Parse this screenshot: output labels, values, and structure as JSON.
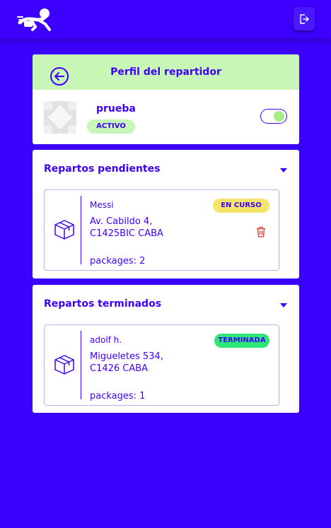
{
  "header": {
    "logo_icon": "courier-logo-icon",
    "logout_icon": "logout-icon"
  },
  "profile": {
    "title": "Perfil del repartidor",
    "back_icon": "back-arrow-circle-icon",
    "username": "prueba",
    "status": "ACTIVO",
    "active": true
  },
  "pending": {
    "title": "Repartos pendientes",
    "items": [
      {
        "client": "Messi",
        "address": "Av. Cabildo 4, C1425BIC CABA",
        "packages": "packages: 2",
        "status": "EN CURSO",
        "status_color": "#f5e36a"
      }
    ]
  },
  "finished": {
    "title": "Repartos terminados",
    "items": [
      {
        "client": "adolf h.",
        "address": "Migueletes 534, C1426 CABA",
        "packages": "packages: 1",
        "status": "TERMINADA",
        "status_color": "#2ee676"
      }
    ]
  },
  "colors": {
    "background": "#3b02fc",
    "accent": "#3d00ff",
    "success": "#c7f6b6",
    "danger": "#e8322e"
  }
}
